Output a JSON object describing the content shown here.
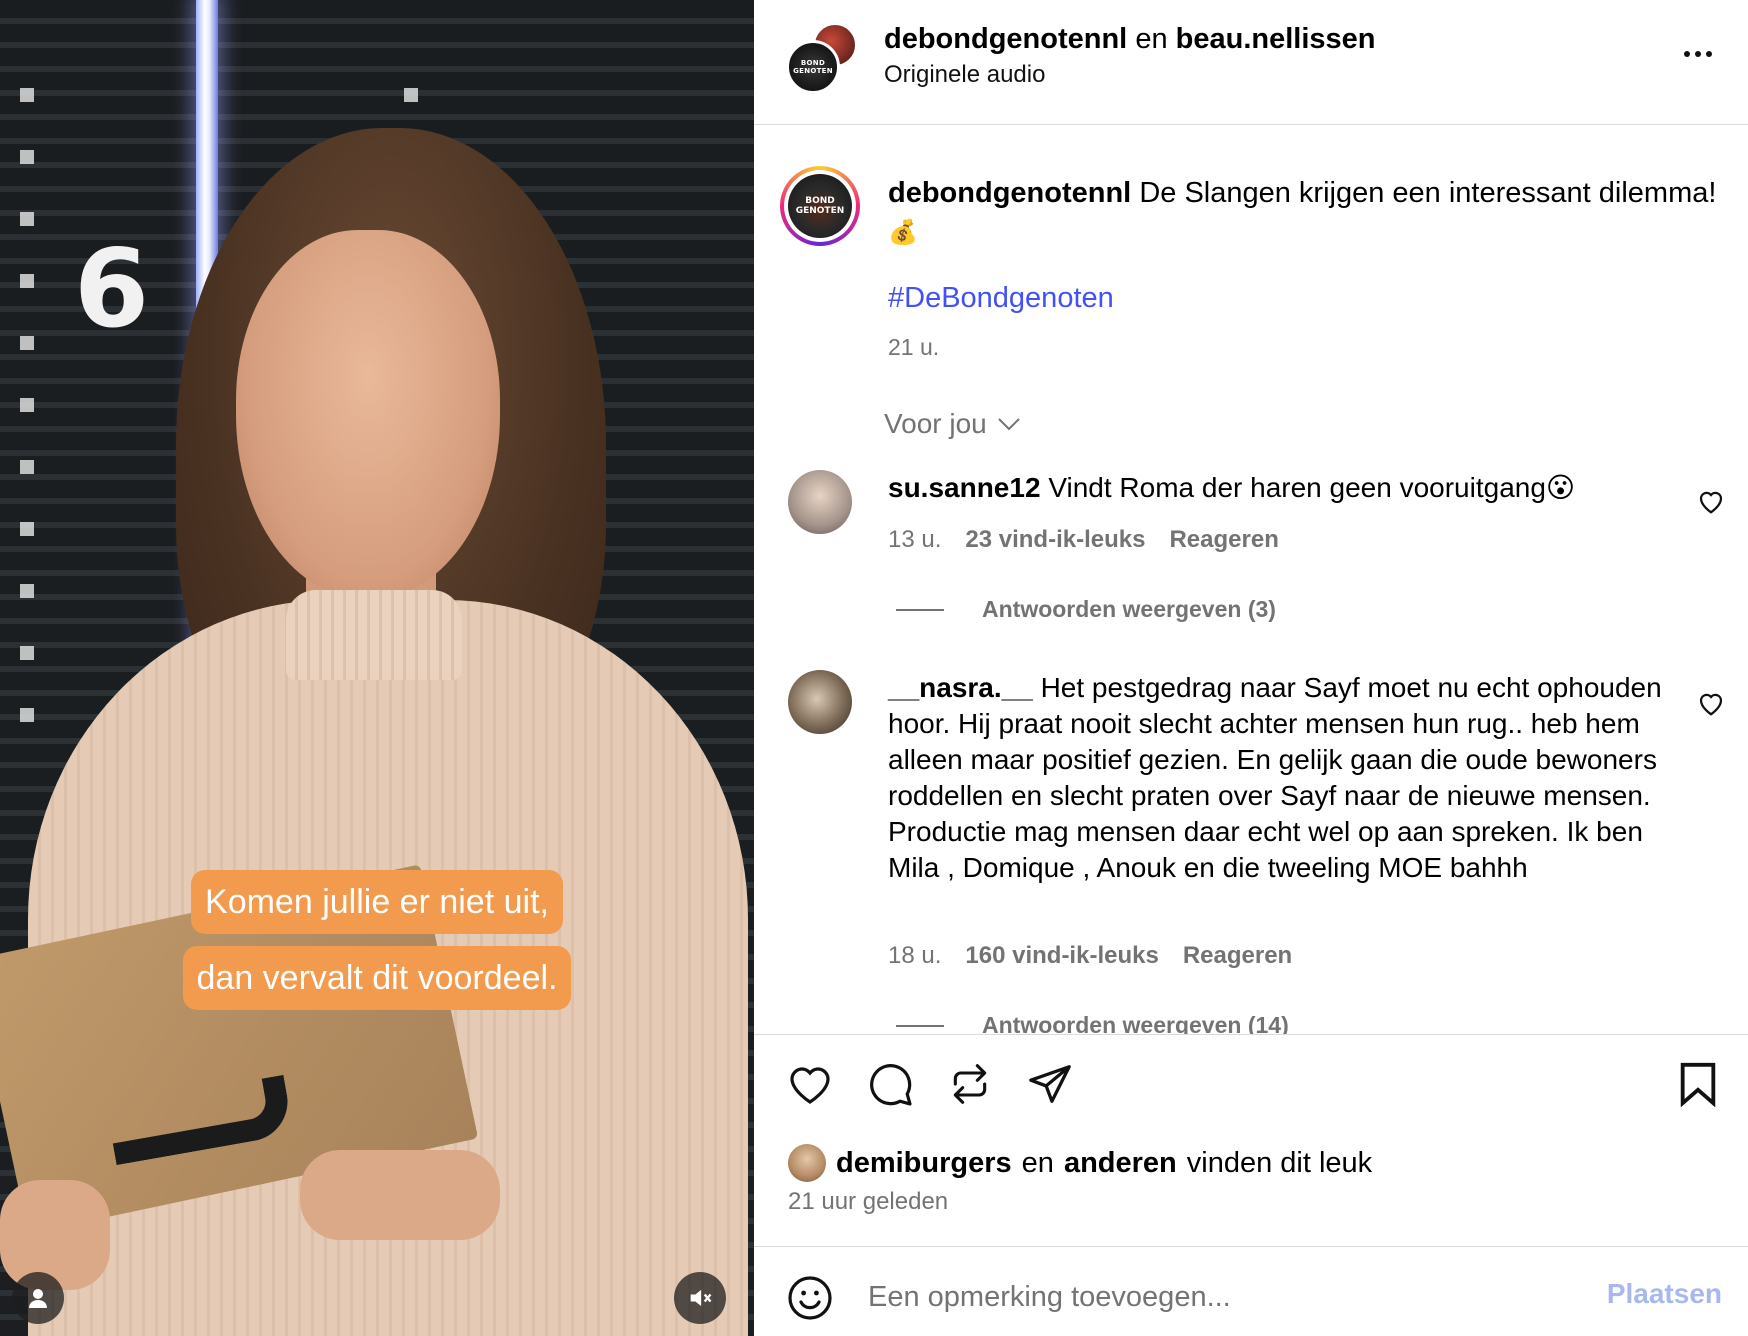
{
  "video": {
    "channel_logo": "6",
    "captions": [
      "Komen jullie er niet uit,",
      "dan vervalt dit voordeel."
    ],
    "user_icon": "person-icon",
    "mute_icon": "speaker-muted-icon"
  },
  "header": {
    "user1": "debondgenotennl",
    "joiner": "en",
    "user2": "beau.nellissen",
    "audio": "Originele audio",
    "avatar_text": "BOND\nGENOTEN"
  },
  "post": {
    "username": "debondgenotennl",
    "caption": "De Slangen krijgen een interessant dilemma!",
    "caption_emoji": "💰",
    "hashtag": "#DeBondgenoten",
    "time": "21 u."
  },
  "filter": {
    "label": "Voor jou"
  },
  "comments": [
    {
      "username": "su.sanne12",
      "text": "Vindt Roma der haren geen vooruitgang😮",
      "time": "13 u.",
      "likes": "23 vind-ik-leuks",
      "reply": "Reageren",
      "replies": "Antwoorden weergeven (3)"
    },
    {
      "username": "__nasra.__",
      "text": "Het pestgedrag naar Sayf moet nu echt ophouden hoor. Hij praat nooit slecht achter mensen hun rug.. heb hem alleen maar positief gezien. En gelijk gaan die oude bewoners roddellen en slecht praten over Sayf naar de nieuwe mensen. Productie mag mensen daar echt wel op aan spreken. Ik ben Mila , Domique , Anouk en die tweeling MOE bahhh",
      "time": "18 u.",
      "likes": "160 vind-ik-leuks",
      "reply": "Reageren",
      "replies": "Antwoorden weergeven (14)"
    }
  ],
  "footer": {
    "liker": "demiburgers",
    "joiner": "en",
    "others": "anderen",
    "suffix": "vinden dit leuk",
    "time": "21 uur geleden",
    "comment_placeholder": "Een opmerking toevoegen...",
    "post_button": "Plaatsen"
  },
  "colors": {
    "link": "#4150f7",
    "caption_bg": "#f29a4d",
    "muted_text": "#737373",
    "post_button": "#a8b8ee"
  }
}
